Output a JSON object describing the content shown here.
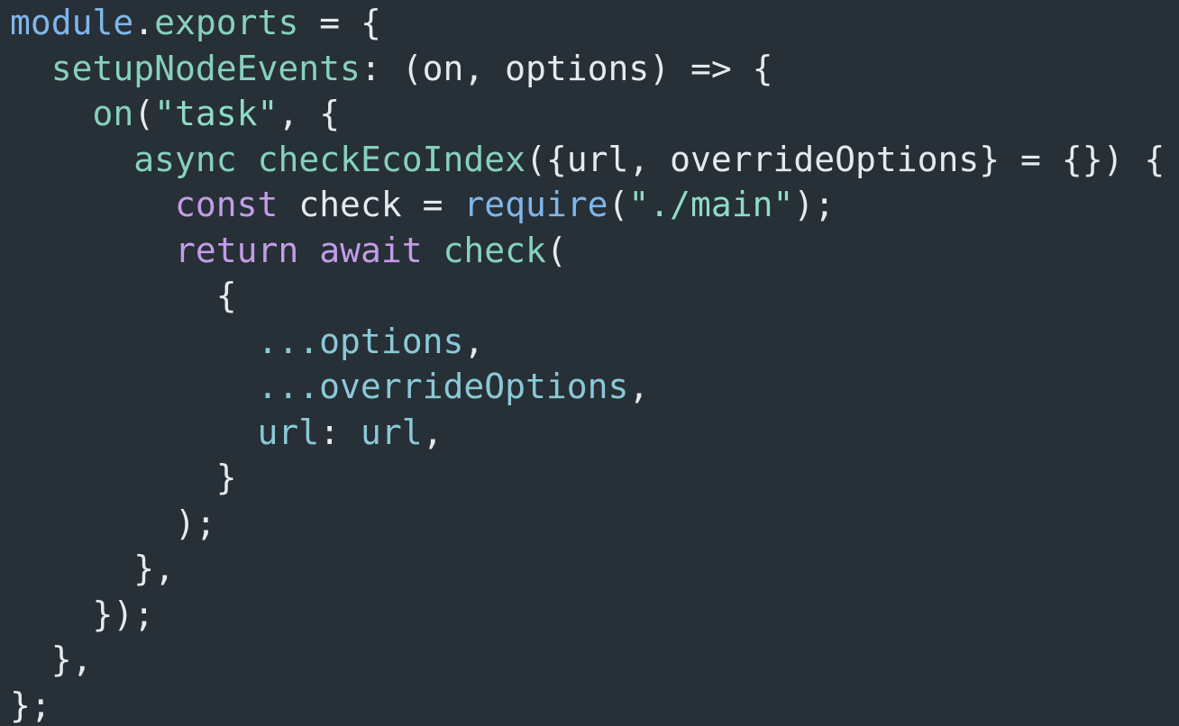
{
  "lines": [
    {
      "tokens": [
        {
          "text": "module",
          "kind": "call"
        },
        {
          "text": ".",
          "kind": "punct"
        },
        {
          "text": "exports",
          "kind": "func"
        },
        {
          "text": " = {",
          "kind": "punct"
        }
      ]
    },
    {
      "tokens": [
        {
          "text": "  ",
          "kind": "plain"
        },
        {
          "text": "setupNodeEvents",
          "kind": "func"
        },
        {
          "text": ": (on, options) => {",
          "kind": "punct"
        }
      ]
    },
    {
      "tokens": [
        {
          "text": "    ",
          "kind": "plain"
        },
        {
          "text": "on",
          "kind": "func"
        },
        {
          "text": "(",
          "kind": "punct"
        },
        {
          "text": "\"task\"",
          "kind": "string"
        },
        {
          "text": ", {",
          "kind": "punct"
        }
      ]
    },
    {
      "tokens": [
        {
          "text": "      ",
          "kind": "plain"
        },
        {
          "text": "async",
          "kind": "func"
        },
        {
          "text": " ",
          "kind": "plain"
        },
        {
          "text": "checkEcoIndex",
          "kind": "func"
        },
        {
          "text": "({url, overrideOptions} = {}) {",
          "kind": "punct"
        }
      ]
    },
    {
      "tokens": [
        {
          "text": "        ",
          "kind": "plain"
        },
        {
          "text": "const",
          "kind": "keyword"
        },
        {
          "text": " check = ",
          "kind": "punct"
        },
        {
          "text": "require",
          "kind": "call"
        },
        {
          "text": "(",
          "kind": "punct"
        },
        {
          "text": "\"./main\"",
          "kind": "string"
        },
        {
          "text": ");",
          "kind": "punct"
        }
      ]
    },
    {
      "tokens": [
        {
          "text": "        ",
          "kind": "plain"
        },
        {
          "text": "return",
          "kind": "keyword"
        },
        {
          "text": " ",
          "kind": "plain"
        },
        {
          "text": "await",
          "kind": "keyword"
        },
        {
          "text": " ",
          "kind": "plain"
        },
        {
          "text": "check",
          "kind": "func"
        },
        {
          "text": "(",
          "kind": "punct"
        }
      ]
    },
    {
      "tokens": [
        {
          "text": "          {",
          "kind": "punct"
        }
      ]
    },
    {
      "tokens": [
        {
          "text": "            ",
          "kind": "plain"
        },
        {
          "text": "...options",
          "kind": "ident"
        },
        {
          "text": ",",
          "kind": "punct"
        }
      ]
    },
    {
      "tokens": [
        {
          "text": "            ",
          "kind": "plain"
        },
        {
          "text": "...overrideOptions",
          "kind": "ident"
        },
        {
          "text": ",",
          "kind": "punct"
        }
      ]
    },
    {
      "tokens": [
        {
          "text": "            ",
          "kind": "plain"
        },
        {
          "text": "url",
          "kind": "ident"
        },
        {
          "text": ": ",
          "kind": "punct"
        },
        {
          "text": "url",
          "kind": "ident"
        },
        {
          "text": ",",
          "kind": "punct"
        }
      ]
    },
    {
      "tokens": [
        {
          "text": "          }",
          "kind": "punct"
        }
      ]
    },
    {
      "tokens": [
        {
          "text": "        );",
          "kind": "punct"
        }
      ]
    },
    {
      "tokens": [
        {
          "text": "      },",
          "kind": "punct"
        }
      ]
    },
    {
      "tokens": [
        {
          "text": "    });",
          "kind": "punct"
        }
      ]
    },
    {
      "tokens": [
        {
          "text": "  },",
          "kind": "punct"
        }
      ]
    },
    {
      "tokens": [
        {
          "text": "};",
          "kind": "punct"
        }
      ]
    }
  ],
  "colors": {
    "background": "#272f37",
    "plain": "#e6e9ee",
    "keyword": "#c39ce9",
    "function": "#86d1bd",
    "call": "#7fb6ec",
    "string": "#8fdcc6",
    "identifier": "#8ac9d6"
  }
}
